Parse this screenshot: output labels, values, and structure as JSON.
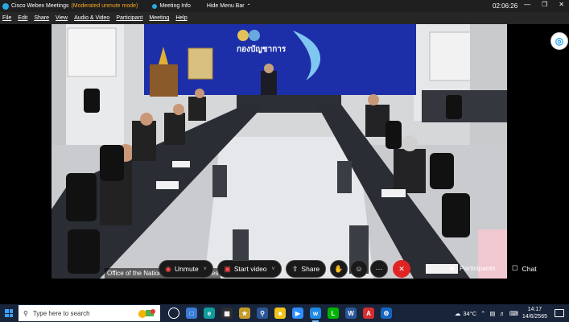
{
  "titlebar": {
    "app_title": "Cisco Webex Meetings",
    "mode": "(Moderated unmute mode)",
    "meeting_info": "Meeting Info",
    "hide_menu_bar": "Hide Menu Bar",
    "clock": "02:06:26"
  },
  "menubar": {
    "items": [
      "File",
      "Edit",
      "Share",
      "View",
      "Audio & Video",
      "Participant",
      "Meeting",
      "Help"
    ]
  },
  "video": {
    "caption": "Office of the National Water Resources",
    "backdrop_text": "กองบัญชาการ"
  },
  "controls": {
    "unmute": "Unmute",
    "start_video": "Start video",
    "share": "Share",
    "participants": "Participants",
    "chat": "Chat"
  },
  "taskbar": {
    "search_placeholder": "Type here to search",
    "temperature": "34°C",
    "time": "14:17",
    "date": "14/6/2565"
  },
  "colors": {
    "titlebar_bg": "#1f1f1f",
    "mode_text": "#f5a623",
    "end_button": "#e02424",
    "backdrop_blue": "#1d2fa8",
    "taskbar_bg": "#17243a"
  }
}
